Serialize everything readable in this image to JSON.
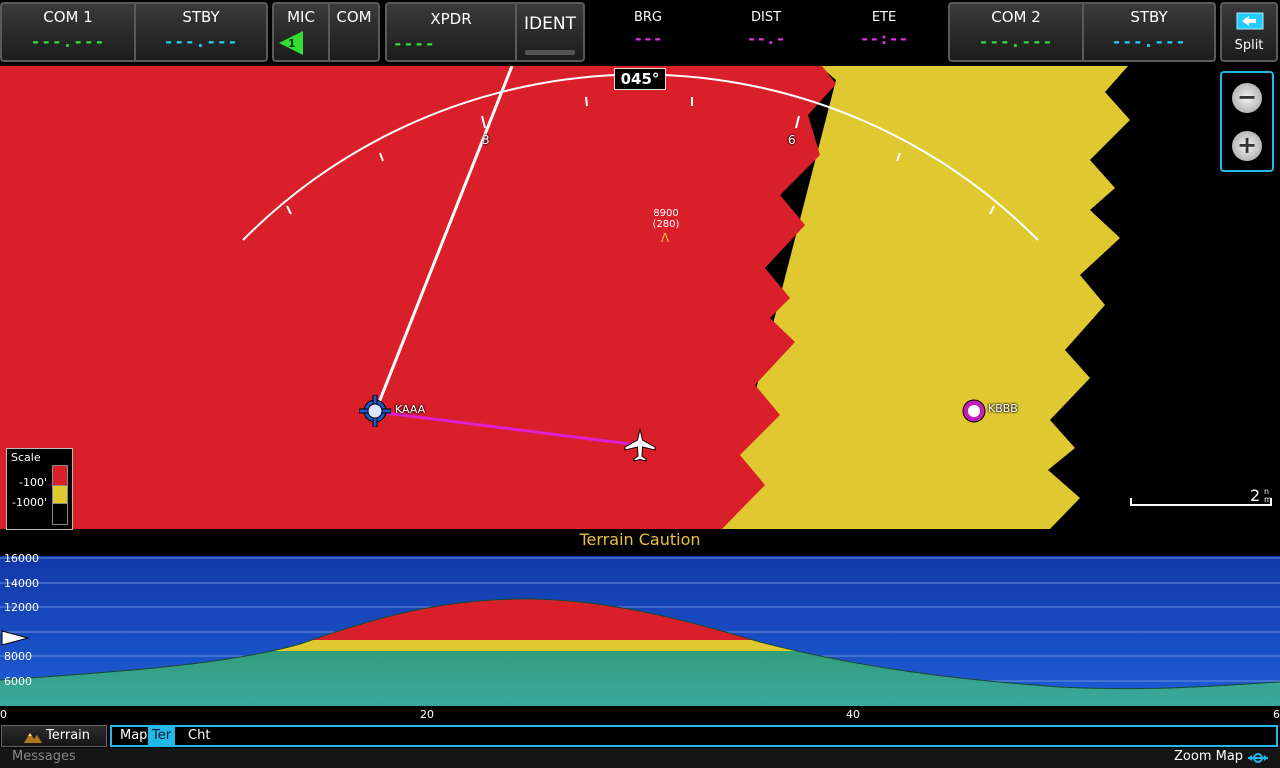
{
  "topbar": {
    "com1": {
      "label": "COM 1",
      "value": "---.---"
    },
    "com1_stby": {
      "label": "STBY",
      "value": "---.---"
    },
    "mic": {
      "label": "MIC",
      "number": "1"
    },
    "com": {
      "label": "COM"
    },
    "xpdr": {
      "label": "XPDR",
      "value": "----"
    },
    "ident": {
      "label": "IDENT"
    },
    "brg": {
      "label": "BRG",
      "value": "---"
    },
    "dist": {
      "label": "DIST",
      "value": "--.-"
    },
    "ete": {
      "label": "ETE",
      "value": "--:--"
    },
    "com2": {
      "label": "COM 2",
      "value": "---.---"
    },
    "com2_stby": {
      "label": "STBY",
      "value": "---.---"
    },
    "split": {
      "label": "Split"
    }
  },
  "map": {
    "heading": "045°",
    "arc_labels": [
      "3",
      "6"
    ],
    "obstacle": {
      "altitude": "8900",
      "agl": "(280)"
    },
    "waypoints": [
      {
        "id": "KAAA"
      },
      {
        "id": "KBBB"
      }
    ],
    "range": "2",
    "range_unit_top": "n",
    "range_unit_bottom": "m",
    "zoom_out_symbol": "−",
    "zoom_in_symbol": "+",
    "scale": {
      "title": "Scale",
      "labels": [
        "-100'",
        "-1000'"
      ]
    }
  },
  "profile": {
    "alert": "Terrain Caution",
    "y_ticks": [
      "16000",
      "14000",
      "12000",
      "8000",
      "6000"
    ],
    "x_ticks": [
      "0",
      "20",
      "40",
      "6"
    ]
  },
  "tabs": {
    "terrain_button": "Terrain",
    "items": [
      "Map",
      "Ter",
      "Cht"
    ],
    "active": "Ter"
  },
  "statusbar": {
    "messages": "Messages",
    "zoom_map": "Zoom Map"
  },
  "colors": {
    "terrain_red": "#d9202a",
    "terrain_yellow": "#e0c830",
    "sky_blue": "#1446b8",
    "accent_cyan": "#22b8e8",
    "route_magenta": "#e020d0"
  }
}
